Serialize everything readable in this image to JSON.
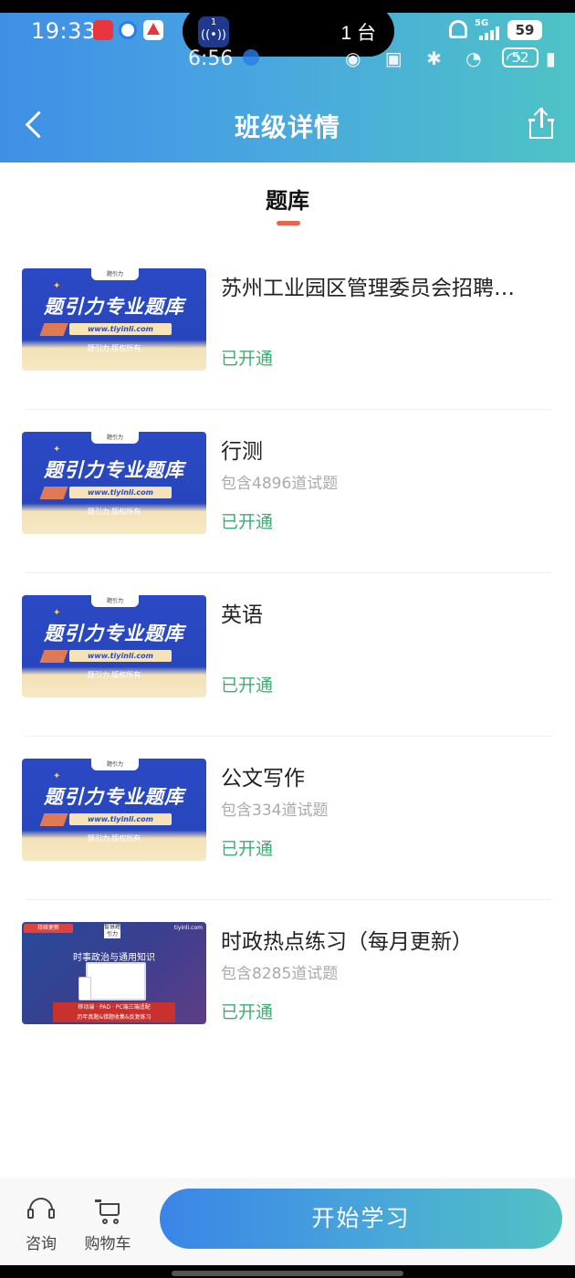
{
  "status_bar": {
    "time": "19:33",
    "island_app_num": "1",
    "island_app_icon": "radio-signal-icon",
    "island_text": "1 台",
    "ghost_time": "6:56",
    "network": "5G",
    "battery": "59",
    "ghost_battery": "52"
  },
  "nav": {
    "title": "班级详情",
    "back_icon": "chevron-left-icon",
    "share_icon": "share-icon"
  },
  "section": {
    "title": "题库",
    "accent_color": "#e3674a"
  },
  "thumb_banner": {
    "headline": "题引力专业题库",
    "url": "www.tiyinli.com",
    "copyright": "题引力 版权所有",
    "logo_text": "题引力"
  },
  "news_banner": {
    "badge": "持续更新",
    "logo": "智慧题引力",
    "site": "tiyinli.com",
    "headline": "时事政治与通用知识",
    "bar_line1": "移动端 · PAD · PC端三端适配",
    "bar_line2": "历年真题&错题收集&反复练习"
  },
  "items": [
    {
      "title": "苏州工业园区管理委员会招聘…",
      "count": "",
      "status": "已开通"
    },
    {
      "title": "行测",
      "count": "包含4896道试题",
      "status": "已开通"
    },
    {
      "title": "英语",
      "count": "",
      "status": "已开通"
    },
    {
      "title": "公文写作",
      "count": "包含334道试题",
      "status": "已开通"
    },
    {
      "title": "时政热点练习（每月更新）",
      "count": "包含8285道试题",
      "status": "已开通"
    }
  ],
  "bottom_bar": {
    "consult_label": "咨询",
    "consult_icon": "headset-icon",
    "cart_label": "购物车",
    "cart_icon": "shopping-cart-icon",
    "start_label": "开始学习"
  },
  "colors": {
    "status_green": "#3dae74",
    "brand_blue": "#3f8fe6",
    "brand_teal": "#4ec3c6"
  }
}
